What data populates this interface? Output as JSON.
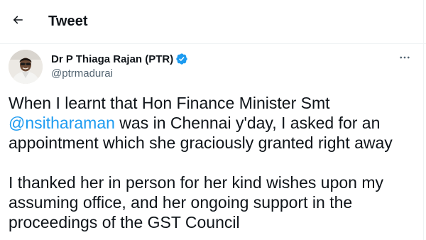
{
  "header": {
    "back_icon": "arrow-left-icon",
    "title": "Tweet"
  },
  "author": {
    "display_name": "Dr P Thiaga Rajan (PTR)",
    "handle": "@ptrmadurai",
    "verified_icon": "verified-badge-icon",
    "more_icon": "more-horizontal-icon"
  },
  "tweet": {
    "p1_line1": "When I learnt that Hon Finance Minister Smt",
    "mention": "@nsitharaman",
    "p1_line2_rest": " was in Chennai y'day, I asked for an",
    "p1_line3": "appointment which she graciously granted right away",
    "p2_line1": "I thanked her in person for her kind wishes upon my",
    "p2_line2": "assuming office, and her ongoing support in the",
    "p2_line3": "proceedings of the GST Council"
  },
  "colors": {
    "accent": "#1d9bf0",
    "text": "#0f1419",
    "secondary": "#536471"
  }
}
